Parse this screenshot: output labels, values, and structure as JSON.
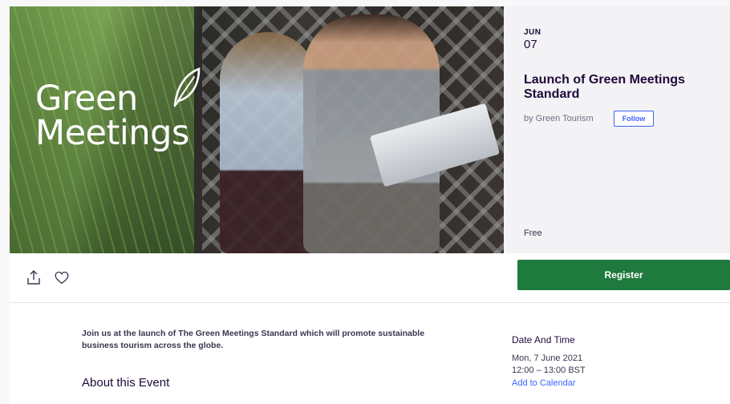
{
  "hero": {
    "logo_line1": "Green",
    "logo_line2": "Meetings"
  },
  "event": {
    "month": "JUN",
    "day": "07",
    "title": "Launch of Green Meetings Standard",
    "organizer": "by Green Tourism",
    "follow_label": "Follow",
    "price": "Free"
  },
  "actions": {
    "share_icon": "share-icon",
    "like_icon": "heart-icon",
    "register_label": "Register"
  },
  "body": {
    "intro": "Join us at the launch of The Green Meetings Standard which will promote sustainable business tourism across the globe.",
    "about_heading": "About this Event"
  },
  "date_time": {
    "heading": "Date And Time",
    "date": "Mon, 7 June 2021",
    "time": "12:00 – 13:00 BST",
    "add_to_calendar": "Add to Calendar"
  },
  "colors": {
    "register": "#1f7a3d",
    "link": "#3d64ff",
    "title": "#1e0a3c"
  }
}
